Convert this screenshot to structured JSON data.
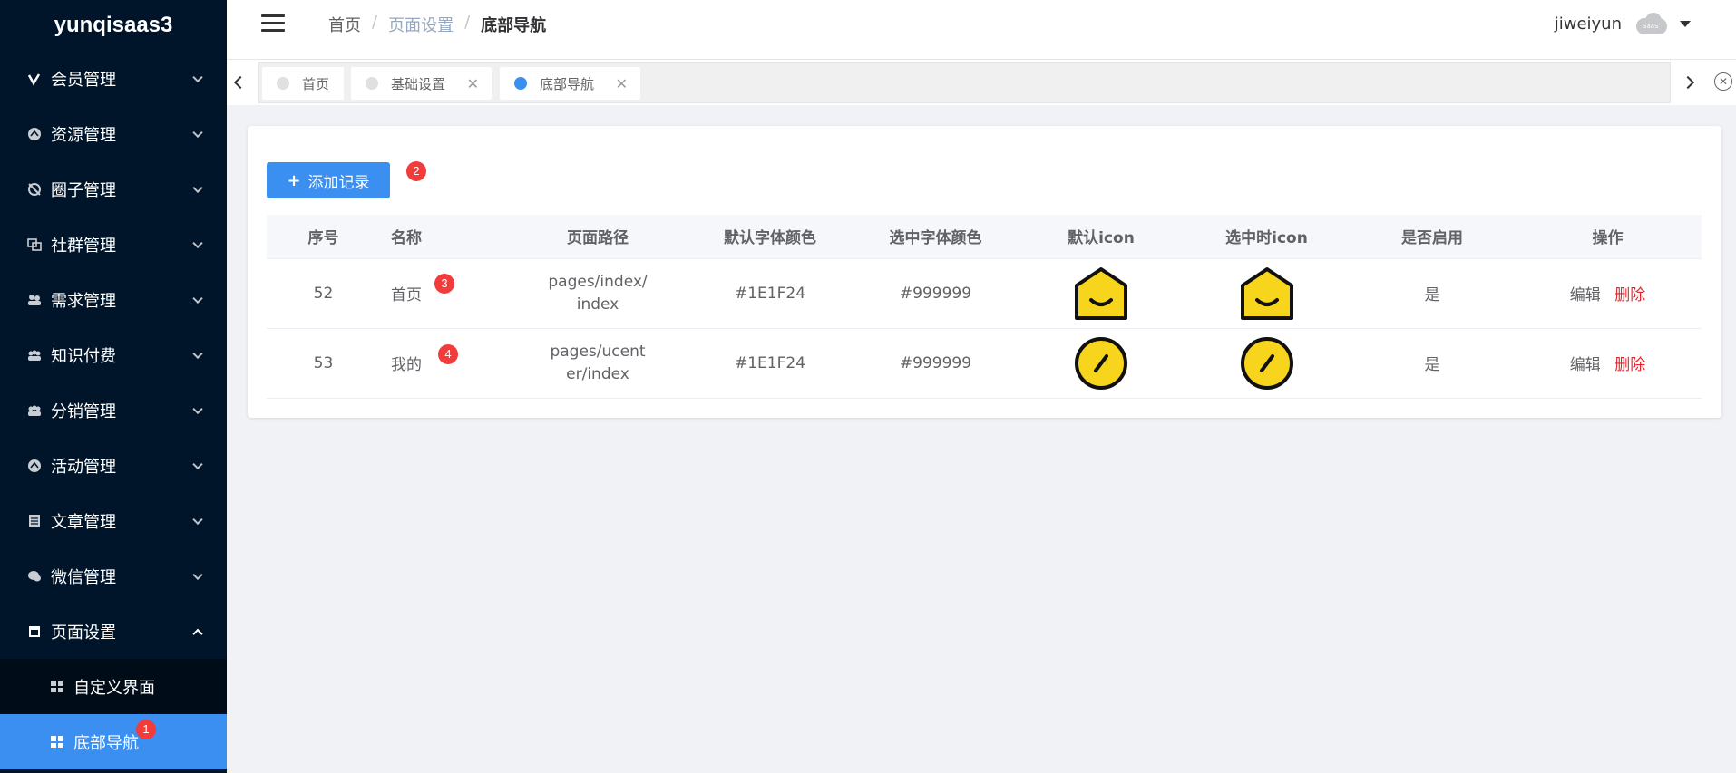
{
  "app": {
    "logo": "yunqisaas3"
  },
  "sidebar": {
    "items": [
      {
        "label": "会员管理",
        "icon": "member-icon"
      },
      {
        "label": "资源管理",
        "icon": "resource-icon"
      },
      {
        "label": "圈子管理",
        "icon": "circle-icon"
      },
      {
        "label": "社群管理",
        "icon": "community-icon"
      },
      {
        "label": "需求管理",
        "icon": "demand-icon"
      },
      {
        "label": "知识付费",
        "icon": "knowledge-icon"
      },
      {
        "label": "分销管理",
        "icon": "distribution-icon"
      },
      {
        "label": "活动管理",
        "icon": "activity-icon"
      },
      {
        "label": "文章管理",
        "icon": "article-icon"
      },
      {
        "label": "微信管理",
        "icon": "wechat-icon"
      },
      {
        "label": "页面设置",
        "icon": "page-settings-icon"
      }
    ],
    "subitems": [
      {
        "label": "自定义界面"
      },
      {
        "label": "底部导航"
      }
    ]
  },
  "header": {
    "breadcrumb": [
      "首页",
      "页面设置",
      "底部导航"
    ],
    "username": "jiweiyun",
    "cloud_text": "SaaS"
  },
  "tabs": [
    {
      "label": "首页"
    },
    {
      "label": "基础设置"
    },
    {
      "label": "底部导航"
    }
  ],
  "badges": {
    "b1": "1",
    "b2": "2",
    "b3": "3",
    "b4": "4"
  },
  "main": {
    "add_button": "添加记录",
    "columns": [
      "序号",
      "名称",
      "页面路径",
      "默认字体颜色",
      "选中字体颜色",
      "默认icon",
      "选中时icon",
      "是否启用",
      "操作"
    ],
    "rows": [
      {
        "id": "52",
        "name": "首页",
        "path": "pages/index/index",
        "default_color": "#1E1F24",
        "selected_color": "#999999",
        "enabled": "是",
        "edit": "编辑",
        "delete": "删除",
        "icon": "home-icon"
      },
      {
        "id": "53",
        "name": "我的",
        "path": "pages/ucenter/index",
        "default_color": "#1E1F24",
        "selected_color": "#999999",
        "enabled": "是",
        "edit": "编辑",
        "delete": "删除",
        "icon": "profile-icon"
      }
    ]
  },
  "colors": {
    "sidebar_bg": "#001529",
    "accent": "#3b8ff0",
    "danger": "#e0252b",
    "badge": "#f23b3b",
    "icon_yellow": "#f7d51d"
  }
}
